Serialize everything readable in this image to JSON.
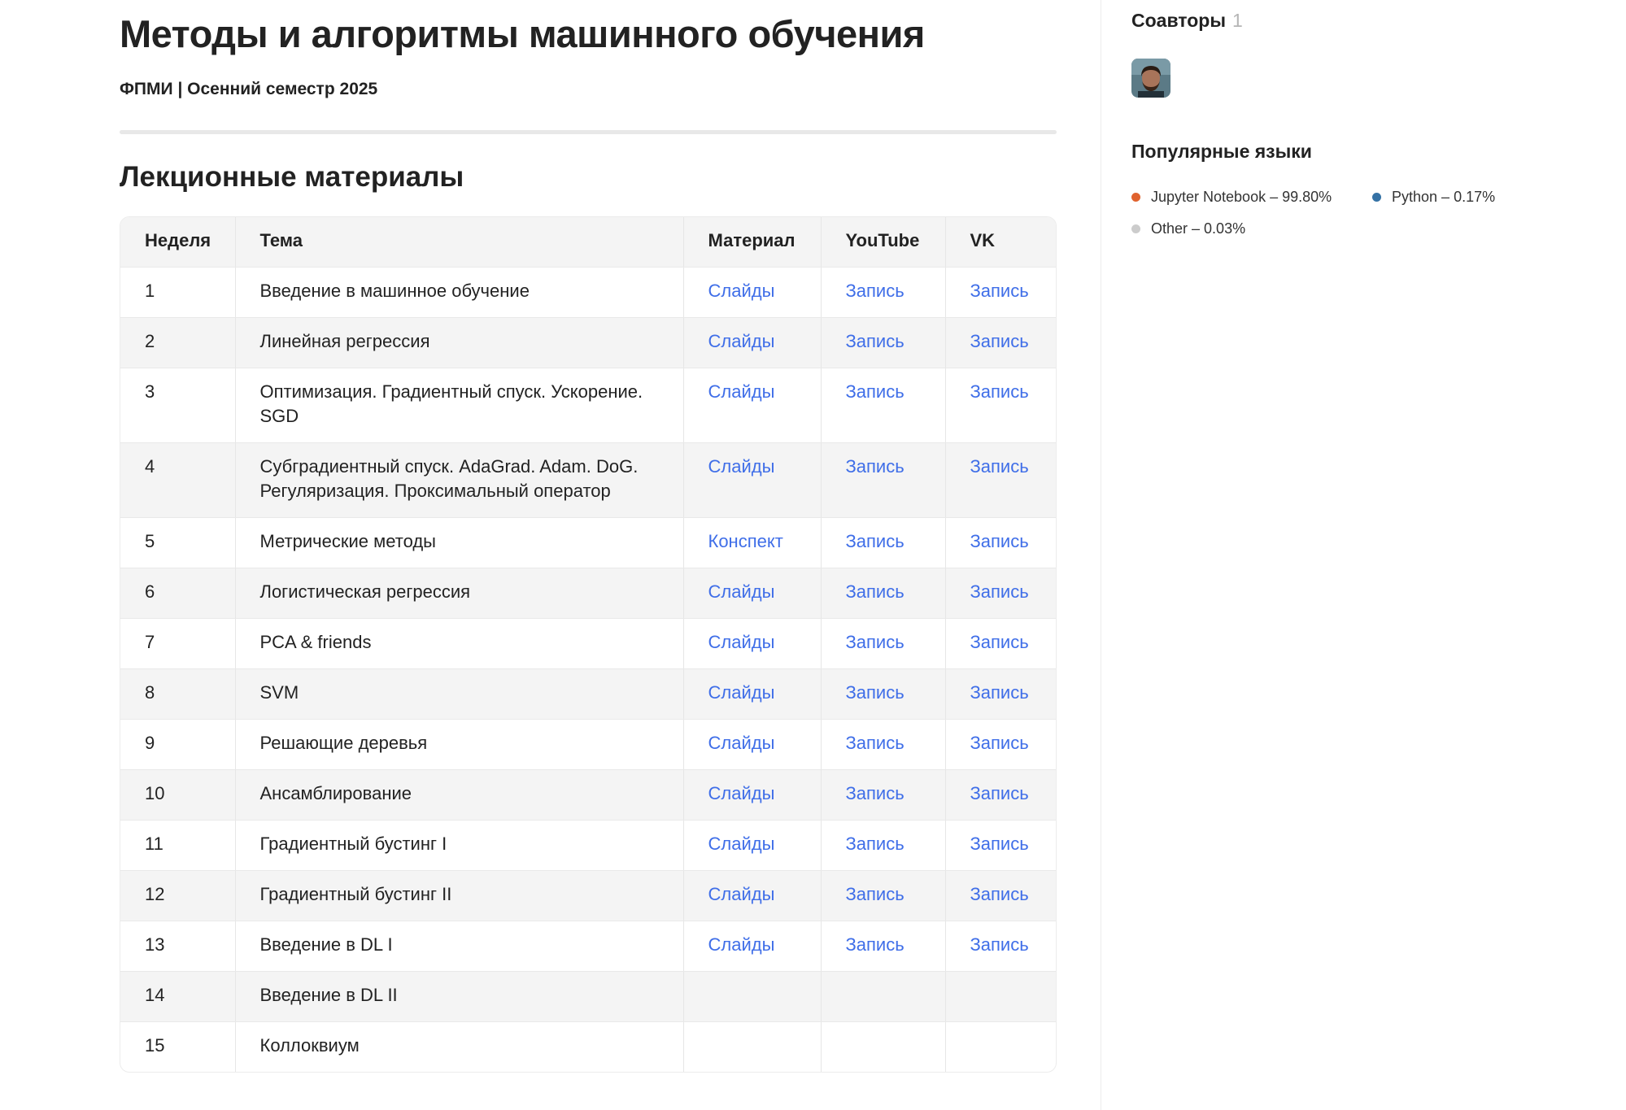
{
  "header": {
    "title": "Методы и алгоритмы машинного обучения",
    "subtitle": "ФПМИ | Осенний семестр 2025"
  },
  "section": {
    "title": "Лекционные материалы"
  },
  "table": {
    "headers": [
      "Неделя",
      "Тема",
      "Материал",
      "YouTube",
      "VK"
    ],
    "rows": [
      {
        "week": "1",
        "topic": "Введение в машинное обучение",
        "material": "Слайды",
        "youtube": "Запись",
        "vk": "Запись"
      },
      {
        "week": "2",
        "topic": "Линейная регрессия",
        "material": "Слайды",
        "youtube": "Запись",
        "vk": "Запись"
      },
      {
        "week": "3",
        "topic": "Оптимизация. Градиентный спуск. Ускорение. SGD",
        "material": "Слайды",
        "youtube": "Запись",
        "vk": "Запись"
      },
      {
        "week": "4",
        "topic": "Субградиентный спуск. AdaGrad. Adam. DoG. Регуляризация. Проксимальный оператор",
        "material": "Слайды",
        "youtube": "Запись",
        "vk": "Запись"
      },
      {
        "week": "5",
        "topic": "Метрические методы",
        "material": "Конспект",
        "youtube": "Запись",
        "vk": "Запись"
      },
      {
        "week": "6",
        "topic": "Логистическая регрессия",
        "material": "Слайды",
        "youtube": "Запись",
        "vk": "Запись"
      },
      {
        "week": "7",
        "topic": "PCA & friends",
        "material": "Слайды",
        "youtube": "Запись",
        "vk": "Запись"
      },
      {
        "week": "8",
        "topic": "SVM",
        "material": "Слайды",
        "youtube": "Запись",
        "vk": "Запись"
      },
      {
        "week": "9",
        "topic": "Решающие деревья",
        "material": "Слайды",
        "youtube": "Запись",
        "vk": "Запись"
      },
      {
        "week": "10",
        "topic": "Ансамблирование",
        "material": "Слайды",
        "youtube": "Запись",
        "vk": "Запись"
      },
      {
        "week": "11",
        "topic": "Градиентный бустинг I",
        "material": "Слайды",
        "youtube": "Запись",
        "vk": "Запись"
      },
      {
        "week": "12",
        "topic": "Градиентный бустинг II",
        "material": "Слайды",
        "youtube": "Запись",
        "vk": "Запись"
      },
      {
        "week": "13",
        "topic": "Введение в DL I",
        "material": "Слайды",
        "youtube": "Запись",
        "vk": "Запись"
      },
      {
        "week": "14",
        "topic": "Введение в DL II",
        "material": "",
        "youtube": "",
        "vk": ""
      },
      {
        "week": "15",
        "topic": "Коллоквиум",
        "material": "",
        "youtube": "",
        "vk": ""
      }
    ]
  },
  "sidebar": {
    "coauthors_title": "Соавторы",
    "coauthors_count": "1",
    "avatar_icon": "user-avatar-icon",
    "languages_title": "Популярные языки",
    "languages": [
      {
        "name": "Jupyter Notebook",
        "percent": "99.80%",
        "color": "#e0622e"
      },
      {
        "name": "Python",
        "percent": "0.17%",
        "color": "#3572a5"
      },
      {
        "name": "Other",
        "percent": "0.03%",
        "color": "#cccccc"
      }
    ]
  },
  "colors": {
    "link": "#3f6ee8",
    "row_alt": "#f4f4f4"
  }
}
